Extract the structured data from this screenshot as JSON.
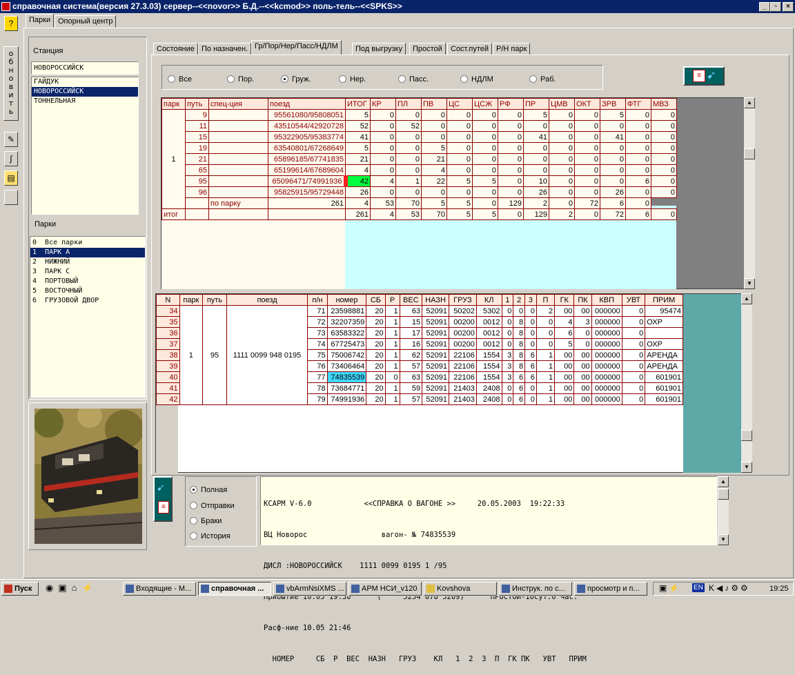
{
  "window": {
    "title": "справочная система(версия 27.3.03) сервер--<<novor>> Б.Д.--<<kcmod>> поль-тель--<<SPKS>>"
  },
  "top_tabs": [
    "Парки",
    "Опорный центр"
  ],
  "left_toolbar": {
    "help": "?",
    "refresh_label": "о\nб\nн\nо\nв\nи\nт\nь"
  },
  "station": {
    "label": "Станция",
    "value": "НОВОРОССИЙСК",
    "items": [
      "ГАЙДУК",
      "НОВОРОССИЙСК",
      "ТОННЕЛЬНАЯ"
    ],
    "selected": 1
  },
  "parks": {
    "label": "Парки",
    "items": [
      "0  Все парки",
      "1  ПАРК А",
      "2  НИЖНИЙ",
      "3  ПАРК С",
      "4  ПОРТОВЫЙ",
      "5  ВОСТОЧНЫЙ",
      "6  ГРУЗОВОЙ ДВОР"
    ],
    "selected": 1
  },
  "tabs": [
    "Состояние",
    "По назначен.",
    "Гр/Пор/Нер/Пасс/НДЛМ",
    "Под выгрузку",
    "Простой",
    "Сост.путей",
    "Р/Н парк"
  ],
  "active_tab": 2,
  "filters": [
    {
      "label": "Все",
      "on": false
    },
    {
      "label": "Пор.",
      "on": false
    },
    {
      "label": "Груж.",
      "on": true
    },
    {
      "label": "Нер.",
      "on": false
    },
    {
      "label": "Пасс.",
      "on": false
    },
    {
      "label": "НДЛМ",
      "on": false
    },
    {
      "label": "Раб.",
      "on": false
    }
  ],
  "grid1": {
    "left_headers": [
      "парк",
      "путь",
      "спец-ция",
      "поезд"
    ],
    "headers": [
      "ИТОГ",
      "КР",
      "ПЛ",
      "ПВ",
      "ЦС",
      "ЦСЖ",
      "РФ",
      "ПР",
      "ЦМВ",
      "ОКТ",
      "ЗРВ",
      "ФТГ",
      "МВЗ"
    ],
    "park": "1",
    "rows": [
      {
        "put": "9",
        "train": "95561080/95808051",
        "v": [
          "5",
          "0",
          "0",
          "0",
          "0",
          "0",
          "0",
          "5",
          "0",
          "0",
          "5",
          "0",
          "0"
        ]
      },
      {
        "put": "11",
        "train": "43510544/42920728",
        "v": [
          "52",
          "0",
          "52",
          "0",
          "0",
          "0",
          "0",
          "0",
          "0",
          "0",
          "0",
          "0",
          "0"
        ]
      },
      {
        "put": "15",
        "train": "95322905/95383774",
        "v": [
          "41",
          "0",
          "0",
          "0",
          "0",
          "0",
          "0",
          "41",
          "0",
          "0",
          "41",
          "0",
          "0"
        ]
      },
      {
        "put": "19",
        "train": "63540801/67268649",
        "v": [
          "5",
          "0",
          "0",
          "5",
          "0",
          "0",
          "0",
          "0",
          "0",
          "0",
          "0",
          "0",
          "0"
        ]
      },
      {
        "put": "21",
        "train": "65896185/67741835",
        "v": [
          "21",
          "0",
          "0",
          "21",
          "0",
          "0",
          "0",
          "0",
          "0",
          "0",
          "0",
          "0",
          "0"
        ]
      },
      {
        "put": "65",
        "train": "65199614/67689604",
        "v": [
          "4",
          "0",
          "0",
          "4",
          "0",
          "0",
          "0",
          "0",
          "0",
          "0",
          "0",
          "0",
          "0"
        ]
      },
      {
        "put": "95",
        "train": "65096471/74991936",
        "v": [
          "42",
          "4",
          "1",
          "22",
          "5",
          "5",
          "0",
          "10",
          "0",
          "0",
          "0",
          "6",
          "0"
        ]
      },
      {
        "put": "96",
        "train": "95825915/95729448",
        "v": [
          "26",
          "0",
          "0",
          "0",
          "0",
          "0",
          "0",
          "26",
          "0",
          "0",
          "26",
          "0",
          "0"
        ]
      }
    ],
    "subtotal_label": "по парку",
    "subtotal": [
      "261",
      "4",
      "53",
      "70",
      "5",
      "5",
      "0",
      "129",
      "2",
      "0",
      "72",
      "6",
      "0"
    ],
    "total_label": "итог",
    "total": [
      "261",
      "4",
      "53",
      "70",
      "5",
      "5",
      "0",
      "129",
      "2",
      "0",
      "72",
      "6",
      "0"
    ]
  },
  "grid2": {
    "headers": [
      "N",
      "парк",
      "путь",
      "поезд",
      "п/н",
      "номер",
      "СБ",
      "Р",
      "ВЕС",
      "НАЗН",
      "ГРУЗ",
      "КЛ",
      "1",
      "2",
      "3",
      "П",
      "ГК",
      "ПК",
      "КВП",
      "УВТ",
      "ПРИМ"
    ],
    "park": "1",
    "put": "95",
    "train": "1111 0099 948 0195",
    "rows": [
      {
        "n": "34",
        "pn": "71",
        "num": "23598881",
        "sb": "20",
        "r": "1",
        "ves": "63",
        "nazn": "52091",
        "gruz": "50202",
        "kl": "5302",
        "c1": "0",
        "c2": "0",
        "c3": "0",
        "p": "2",
        "gk": "00",
        "pk": "00",
        "kvp": "000000",
        "uvt": "0",
        "prim": "95474"
      },
      {
        "n": "35",
        "pn": "72",
        "num": "32207359",
        "sb": "20",
        "r": "1",
        "ves": "15",
        "nazn": "52091",
        "gruz": "00200",
        "kl": "0012",
        "c1": "0",
        "c2": "8",
        "c3": "0",
        "p": "0",
        "gk": "4",
        "pk": "3",
        "kvp": "000000",
        "uvt": "0",
        "prim": "ОХР"
      },
      {
        "n": "36",
        "pn": "73",
        "num": "63583322",
        "sb": "20",
        "r": "1",
        "ves": "17",
        "nazn": "52091",
        "gruz": "00200",
        "kl": "0012",
        "c1": "0",
        "c2": "8",
        "c3": "0",
        "p": "0",
        "gk": "6",
        "pk": "0",
        "kvp": "000000",
        "uvt": "0",
        "prim": ""
      },
      {
        "n": "37",
        "pn": "74",
        "num": "67725473",
        "sb": "20",
        "r": "1",
        "ves": "16",
        "nazn": "52091",
        "gruz": "00200",
        "kl": "0012",
        "c1": "0",
        "c2": "8",
        "c3": "0",
        "p": "0",
        "gk": "5",
        "pk": "0",
        "kvp": "000000",
        "uvt": "0",
        "prim": "ОХР"
      },
      {
        "n": "38",
        "pn": "75",
        "num": "75006742",
        "sb": "20",
        "r": "1",
        "ves": "62",
        "nazn": "52091",
        "gruz": "22106",
        "kl": "1554",
        "c1": "3",
        "c2": "8",
        "c3": "6",
        "p": "1",
        "gk": "00",
        "pk": "00",
        "kvp": "000000",
        "uvt": "0",
        "prim": "АРЕНДА"
      },
      {
        "n": "39",
        "pn": "76",
        "num": "73406464",
        "sb": "20",
        "r": "1",
        "ves": "57",
        "nazn": "52091",
        "gruz": "22106",
        "kl": "1554",
        "c1": "3",
        "c2": "8",
        "c3": "6",
        "p": "1",
        "gk": "00",
        "pk": "00",
        "kvp": "000000",
        "uvt": "0",
        "prim": "АРЕНДА"
      },
      {
        "n": "40",
        "pn": "77",
        "num": "74835539",
        "sb": "20",
        "r": "0",
        "ves": "63",
        "nazn": "52091",
        "gruz": "22106",
        "kl": "1554",
        "c1": "3",
        "c2": "6",
        "c3": "6",
        "p": "1",
        "gk": "00",
        "pk": "00",
        "kvp": "000000",
        "uvt": "0",
        "prim": "601901"
      },
      {
        "n": "41",
        "pn": "78",
        "num": "73684771",
        "sb": "20",
        "r": "1",
        "ves": "59",
        "nazn": "52091",
        "gruz": "21403",
        "kl": "2408",
        "c1": "0",
        "c2": "6",
        "c3": "0",
        "p": "1",
        "gk": "00",
        "pk": "00",
        "kvp": "000000",
        "uvt": "0",
        "prim": "601901"
      },
      {
        "n": "42",
        "pn": "79",
        "num": "74991936",
        "sb": "20",
        "r": "1",
        "ves": "57",
        "nazn": "52091",
        "gruz": "21403",
        "kl": "2408",
        "c1": "0",
        "c2": "6",
        "c3": "0",
        "p": "1",
        "gk": "00",
        "pk": "00",
        "kvp": "000000",
        "uvt": "0",
        "prim": "601901"
      }
    ]
  },
  "report_options": [
    {
      "label": "Полная",
      "on": true
    },
    {
      "label": "Отправки",
      "on": false
    },
    {
      "label": "Браки",
      "on": false
    },
    {
      "label": "История",
      "on": false
    }
  ],
  "report_text": [
    "КСАРМ V-6.0            <<СПРАВКА О ВАГОНЕ >>     20.05.2003  19:22:33",
    "ВЦ Новорос                 вагон- № 74835539",
    "ДИСЛ :НОВОРОССИЙСК    1111 0099 0195 1 /95",
    "Прибытие 10.05 19:30      (     5254 078 5209)      ПРОСТОЙ-10сут.0 час.",
    "Расф-ние 10.05 21:46",
    "  НОМЕР     СБ  Р  ВЕС  НАЗН   ГРУЗ    КЛ   1  2  3  П  ГК ПК   УВТ   ПРИМ"
  ],
  "taskbar": {
    "start": "Пуск",
    "tasks": [
      "Входящие - M...",
      "справочная ...",
      "vbArmNsiXMS ...",
      "АРМ НСИ_v120",
      "Kovshova",
      "Инструк. по с...",
      "просмотр и п..."
    ],
    "active": 1,
    "lang": "EN",
    "clock": "19:25"
  }
}
